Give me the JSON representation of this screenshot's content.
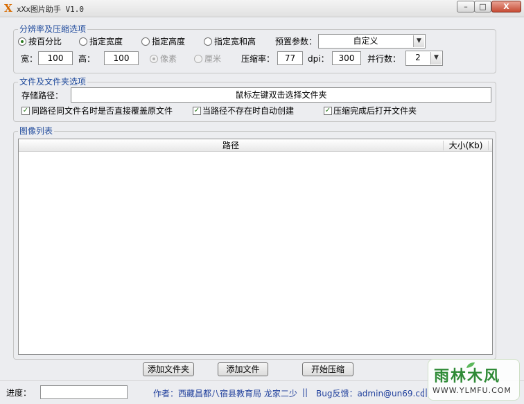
{
  "window": {
    "title": "xXx图片助手 V1.0",
    "app_icon_glyph": "X",
    "controls": {
      "minimize": "–",
      "maximize": "□",
      "close": "X"
    }
  },
  "resolution_group": {
    "legend": "分辨率及压缩选项",
    "radios": [
      {
        "label": "按百分比",
        "checked": true
      },
      {
        "label": "指定宽度",
        "checked": false
      },
      {
        "label": "指定高度",
        "checked": false
      },
      {
        "label": "指定宽和高",
        "checked": false
      }
    ],
    "preset_label": "预置参数：",
    "preset_value": "自定义",
    "width_label": "宽：",
    "width_value": "100",
    "height_label": "高：",
    "height_value": "100",
    "unit_pixel": "像素",
    "unit_cm": "厘米",
    "compression_label": "压缩率：",
    "compression_value": "77",
    "dpi_label": "dpi：",
    "dpi_value": "300",
    "parallel_label": "并行数：",
    "parallel_value": "2"
  },
  "folder_group": {
    "legend": "文件及文件夹选项",
    "save_path_label": "存储路径：",
    "save_path_value": "鼠标左键双击选择文件夹",
    "checkboxes": [
      {
        "label": "同路径同文件名时是否直接覆盖原文件",
        "checked": true
      },
      {
        "label": "当路径不存在时自动创建",
        "checked": true
      },
      {
        "label": "压缩完成后打开文件夹",
        "checked": true
      }
    ]
  },
  "image_list": {
    "legend": "图像列表",
    "columns": [
      "路径",
      "大小(Kb)"
    ]
  },
  "buttons": {
    "add_folder": "添加文件夹",
    "add_file": "添加文件",
    "start": "开始压缩"
  },
  "status": {
    "progress_label": "进度：",
    "author": "作者：西藏昌都八宿县教育局 龙家二少",
    "separator": "||",
    "bug_report": "Bug反馈：admin@un69.cc",
    "separator2": "||"
  },
  "watermark": {
    "text": "雨林木风",
    "url": "WWW.YLMFU.COM"
  }
}
